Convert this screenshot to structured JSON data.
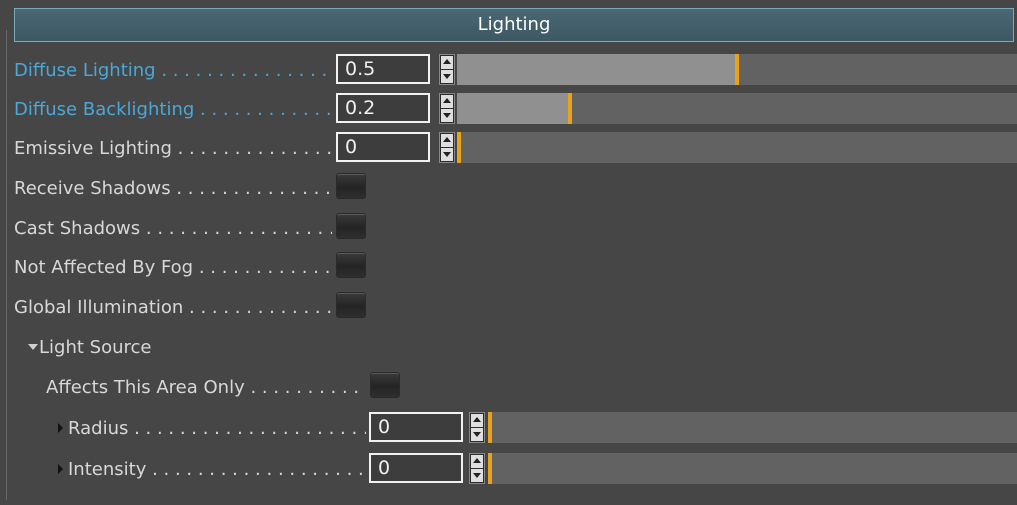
{
  "panel": {
    "title": "Lighting"
  },
  "rows": {
    "diffuse_lighting": {
      "label": "Diffuse Lighting . . . . . . . . . . . . . . . . . . . . . . .",
      "value": "0.5",
      "slider_fraction": 0.5
    },
    "diffuse_backlighting": {
      "label": "Diffuse Backlighting . . . . . . . . . . . . . . . . . . . . .",
      "value": "0.2",
      "slider_fraction": 0.2
    },
    "emissive_lighting": {
      "label": "Emissive Lighting . . . . . . . . . . . . . . . . . . . . . . .",
      "value": "0",
      "slider_fraction": 0
    },
    "receive_shadows": {
      "label": "Receive Shadows . . . . . . . . . . . . . . . . . . . . . . . ."
    },
    "cast_shadows": {
      "label": "Cast Shadows . . . . . . . . . . . . . . . . . . . . . . . . . ."
    },
    "not_affected_by_fog": {
      "label": "Not Affected By Fog . . . . . . . . . . . . . . . . . . . . . ."
    },
    "global_illumination": {
      "label": "Global Illumination . . . . . . . . . . . . . . . . . . . . . ."
    }
  },
  "light_source": {
    "label": "Light Source",
    "affects_this_area_only": {
      "label": "Affects This Area Only . . . . . . . . . . . . . . . . . . . . ."
    },
    "radius": {
      "label": "Radius . . . . . . . . . . . . . . . . . . . . . . . . . . . . . .",
      "value": "0",
      "slider_fraction": 0
    },
    "intensity": {
      "label": "Intensity . . . . . . . . . . . . . . . . . . . . . . . . . . . .",
      "value": "0",
      "slider_fraction": 0
    }
  },
  "colors": {
    "background": "#464646",
    "header_border": "#78aabb",
    "label_highlight": "#4aa8d8",
    "slider_handle": "#e8a318",
    "slider_fill": "#909090",
    "slider_track": "#626262"
  }
}
